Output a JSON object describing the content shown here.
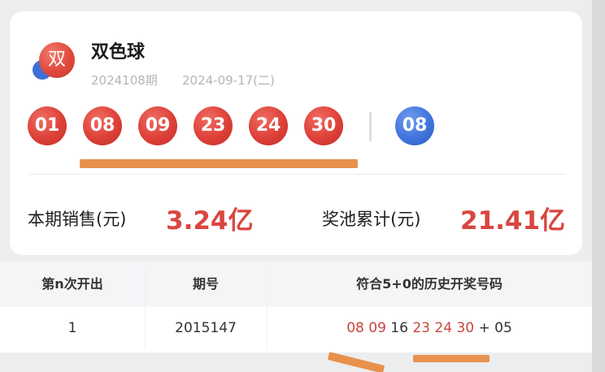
{
  "lottery": {
    "logo_char": "双",
    "name": "双色球",
    "issue": "2024108期",
    "date": "2024-09-17(二)",
    "red_balls": [
      "01",
      "08",
      "09",
      "23",
      "24",
      "30"
    ],
    "blue_ball": "08"
  },
  "stats": {
    "sales_label": "本期销售(元)",
    "sales_value": "3.24亿",
    "pool_label": "奖池累计(元)",
    "pool_value": "21.41亿"
  },
  "table": {
    "headers": [
      "第n次开出",
      "期号",
      "符合5+0的历史开奖号码"
    ],
    "rows": [
      {
        "count": "1",
        "issue": "2015147",
        "numbers": [
          "08",
          "09",
          "16",
          "23",
          "24",
          "30"
        ],
        "plus": "+",
        "blue": "05"
      }
    ]
  },
  "colors": {
    "red_ball": "#dd4038",
    "blue_ball": "#3f74dc",
    "accent_value": "#d9463f",
    "annotation_orange": "#e8914d"
  }
}
